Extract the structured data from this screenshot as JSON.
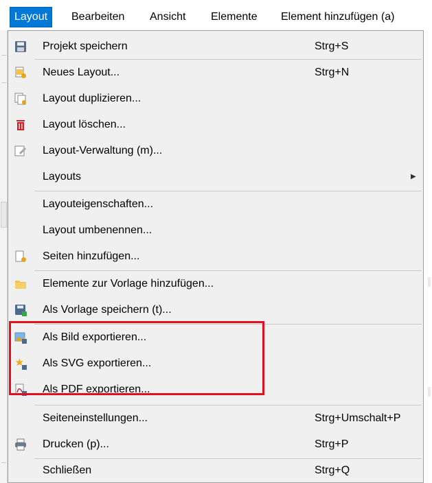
{
  "menubar": {
    "items": [
      {
        "label": "Layout",
        "active": true
      },
      {
        "label": "Bearbeiten"
      },
      {
        "label": "Ansicht"
      },
      {
        "label": "Elemente"
      },
      {
        "label": "Element hinzufügen (a)"
      }
    ]
  },
  "menu": {
    "items": [
      {
        "label": "Projekt speichern",
        "shortcut": "Strg+S",
        "icon": "save-icon"
      },
      {
        "label": "Neues Layout...",
        "shortcut": "Strg+N",
        "icon": "new-layout-icon"
      },
      {
        "label": "Layout duplizieren...",
        "icon": "duplicate-layout-icon"
      },
      {
        "label": "Layout löschen...",
        "icon": "trash-icon"
      },
      {
        "label": "Layout-Verwaltung (m)...",
        "icon": "layout-manager-icon"
      },
      {
        "label": "Layouts",
        "submenu": true
      },
      {
        "label": "Layouteigenschaften..."
      },
      {
        "label": "Layout umbenennen..."
      },
      {
        "label": "Seiten hinzufügen...",
        "icon": "add-pages-icon"
      },
      {
        "label": "Elemente zur Vorlage hinzufügen...",
        "icon": "folder-icon"
      },
      {
        "label": "Als Vorlage speichern (t)...",
        "icon": "save-template-icon"
      },
      {
        "label": "Als Bild exportieren...",
        "icon": "export-image-icon"
      },
      {
        "label": "Als SVG exportieren...",
        "icon": "export-svg-icon"
      },
      {
        "label": "Als PDF exportieren...",
        "icon": "export-pdf-icon"
      },
      {
        "label": "Seiteneinstellungen...",
        "shortcut": "Strg+Umschalt+P"
      },
      {
        "label": "Drucken (p)...",
        "shortcut": "Strg+P",
        "icon": "printer-icon"
      },
      {
        "label": "Schließen",
        "shortcut": "Strg+Q"
      }
    ]
  },
  "colors": {
    "menubar_active": "#0078d7",
    "highlight_box": "#e0101e",
    "menu_background": "#f0f0f0"
  }
}
